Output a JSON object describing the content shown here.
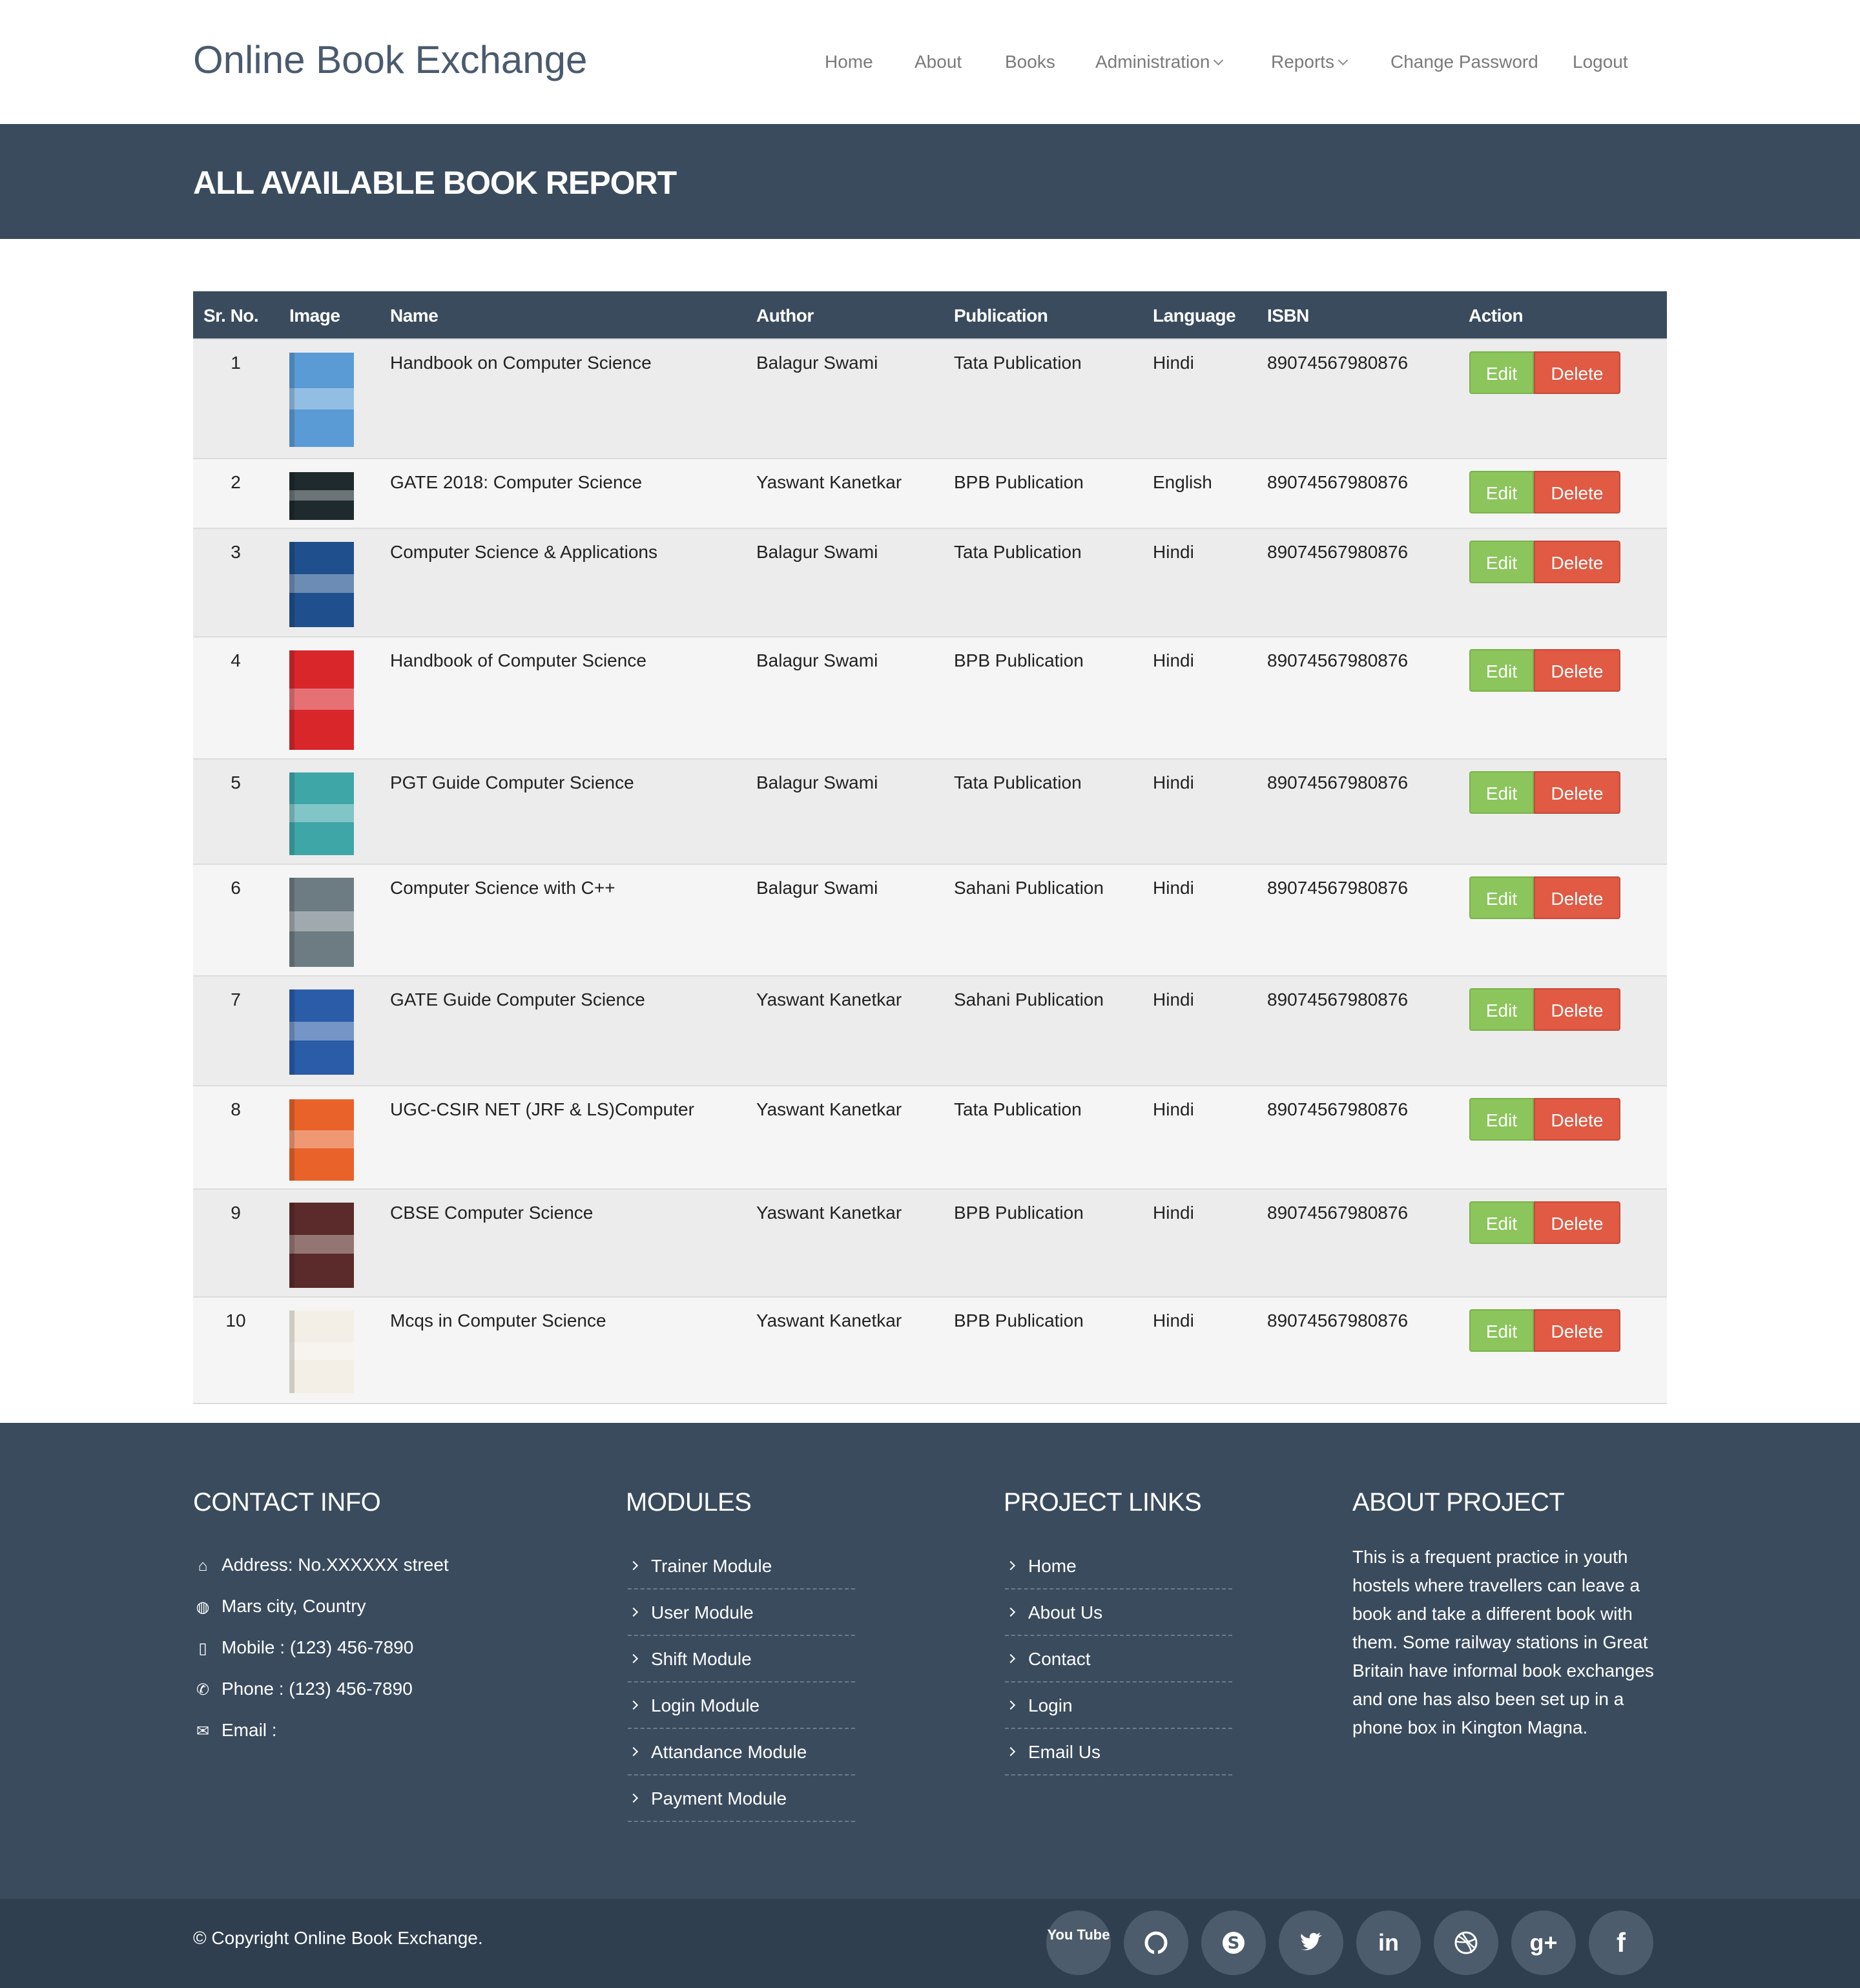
{
  "header": {
    "brand": "Online Book Exchange",
    "nav": [
      {
        "label": "Home"
      },
      {
        "label": "About"
      },
      {
        "label": "Books"
      },
      {
        "label": "Administration"
      },
      {
        "label": "Reports"
      },
      {
        "label": "Change Password"
      },
      {
        "label": "Logout"
      }
    ]
  },
  "page": {
    "title": "ALL AVAILABLE BOOK REPORT"
  },
  "table": {
    "columns": [
      "Sr. No.",
      "Image",
      "Name",
      "Author",
      "Publication",
      "Language",
      "ISBN",
      "Action"
    ],
    "edit_label": "Edit",
    "delete_label": "Delete",
    "rows": [
      {
        "sr": "1",
        "name": "Handbook on Computer Science",
        "author": "Balagur Swami",
        "publication": "Tata Publication",
        "language": "Hindi",
        "isbn": "89074567980876",
        "cover_color": "#5a9bd5"
      },
      {
        "sr": "2",
        "name": "GATE 2018: Computer Science",
        "author": "Yaswant Kanetkar",
        "publication": "BPB Publication",
        "language": "English",
        "isbn": "89074567980876",
        "cover_color": "#1e2a2e"
      },
      {
        "sr": "3",
        "name": "Computer Science & Applications",
        "author": "Balagur Swami",
        "publication": "Tata Publication",
        "language": "Hindi",
        "isbn": "89074567980876",
        "cover_color": "#1f4f8c"
      },
      {
        "sr": "4",
        "name": "Handbook of Computer Science",
        "author": "Balagur Swami",
        "publication": "BPB Publication",
        "language": "Hindi",
        "isbn": "89074567980876",
        "cover_color": "#d9262b"
      },
      {
        "sr": "5",
        "name": "PGT Guide Computer Science",
        "author": "Balagur Swami",
        "publication": "Tata Publication",
        "language": "Hindi",
        "isbn": "89074567980876",
        "cover_color": "#3fa6a8"
      },
      {
        "sr": "6",
        "name": "Computer Science with C++",
        "author": "Balagur Swami",
        "publication": "Sahani Publication",
        "language": "Hindi",
        "isbn": "89074567980876",
        "cover_color": "#6d7b82"
      },
      {
        "sr": "7",
        "name": "GATE Guide Computer Science",
        "author": "Yaswant Kanetkar",
        "publication": "Sahani Publication",
        "language": "Hindi",
        "isbn": "89074567980876",
        "cover_color": "#2a5ca8"
      },
      {
        "sr": "8",
        "name": "UGC-CSIR NET (JRF & LS)Computer",
        "author": "Yaswant Kanetkar",
        "publication": "Tata Publication",
        "language": "Hindi",
        "isbn": "89074567980876",
        "cover_color": "#e8622a"
      },
      {
        "sr": "9",
        "name": "CBSE Computer Science",
        "author": "Yaswant Kanetkar",
        "publication": "BPB Publication",
        "language": "Hindi",
        "isbn": "89074567980876",
        "cover_color": "#5a2b2a"
      },
      {
        "sr": "10",
        "name": "Mcqs in Computer Science",
        "author": "Yaswant Kanetkar",
        "publication": "BPB Publication",
        "language": "Hindi",
        "isbn": "89074567980876",
        "cover_color": "#f3efe6"
      }
    ]
  },
  "footer": {
    "contact": {
      "title": "CONTACT INFO",
      "address": "Address: No.XXXXXX street",
      "city": "Mars city, Country",
      "mobile": "Mobile : (123) 456-7890",
      "phone": "Phone : (123) 456-7890",
      "email": "Email :"
    },
    "modules": {
      "title": "MODULES",
      "items": [
        "Trainer Module",
        "User Module",
        "Shift Module",
        "Login Module",
        "Attandance Module",
        "Payment Module"
      ]
    },
    "project_links": {
      "title": "PROJECT LINKS",
      "items": [
        "Home",
        "About Us",
        "Contact",
        "Login",
        "Email Us"
      ]
    },
    "about": {
      "title": "ABOUT PROJECT",
      "text": "This is a frequent practice in youth hostels where travellers can leave a book and take a different book with them. Some railway stations in Great Britain have informal book exchanges and one has also been set up in a phone box in Kington Magna."
    },
    "copyright": "© Copyright Online Book Exchange.",
    "social": [
      "youtube-icon",
      "github-icon",
      "skype-icon",
      "twitter-icon",
      "linkedin-icon",
      "dribbble-icon",
      "google-plus-icon",
      "facebook-icon"
    ],
    "social_text": {
      "youtube": "You Tube",
      "linkedin": "in",
      "google_plus": "g+",
      "facebook": "f"
    }
  },
  "colors": {
    "banner": "#3a4b5e",
    "edit": "#8bc55c",
    "delete": "#e05a44",
    "footer": "#3a4b5e",
    "bottombar": "#2f3f50"
  }
}
